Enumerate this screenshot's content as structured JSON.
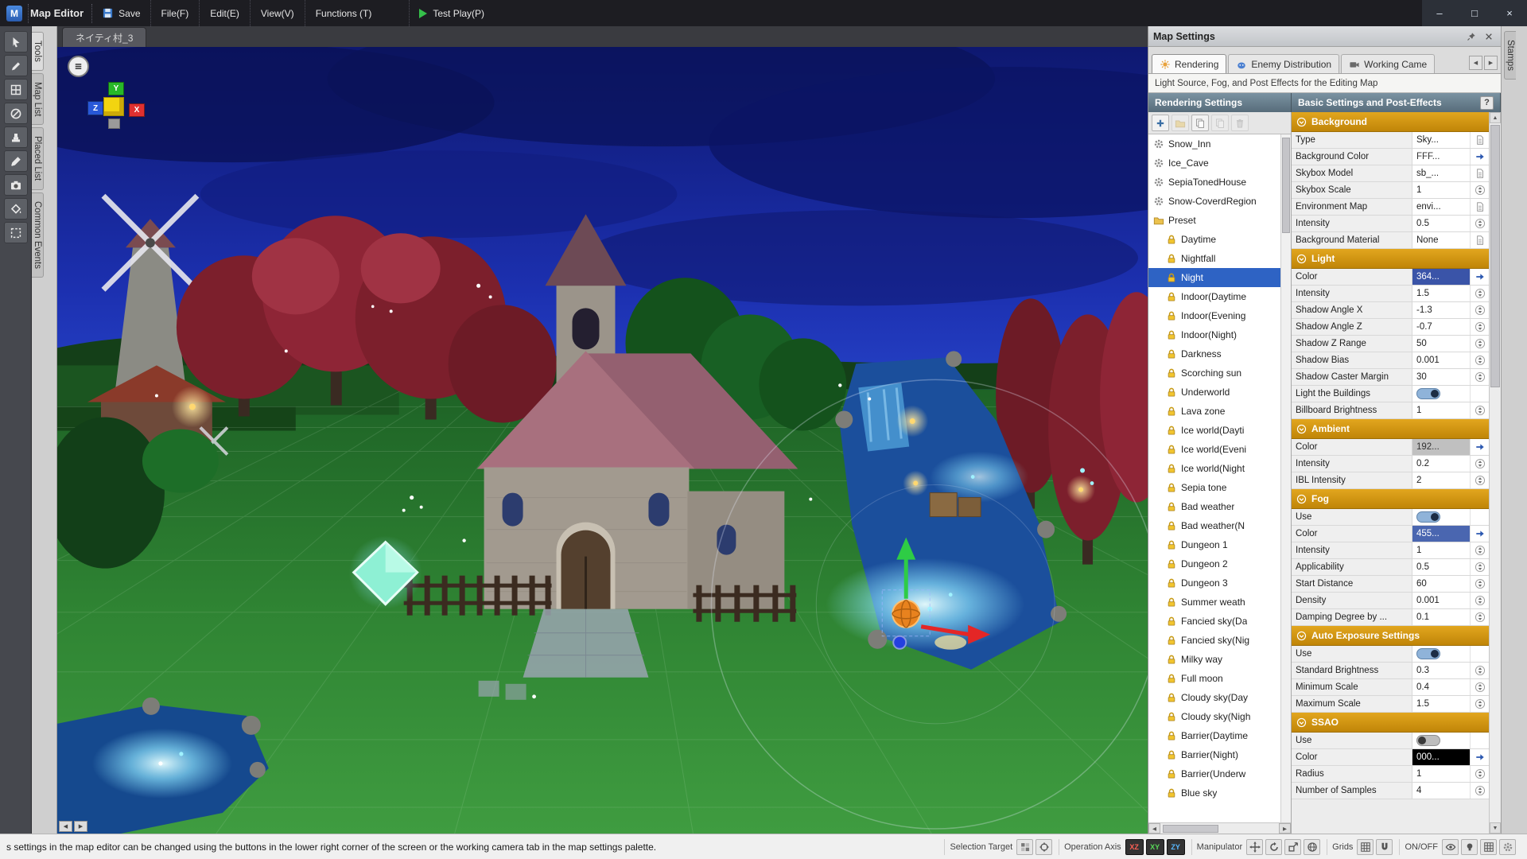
{
  "window": {
    "title": "Map Editor",
    "controls": {
      "minimize": "–",
      "maximize": "□",
      "close": "×"
    }
  },
  "menubar": {
    "save": "Save",
    "items": [
      "File(F)",
      "Edit(E)",
      "View(V)",
      "Functions (T)"
    ],
    "test_play": "Test Play(P)"
  },
  "left_toolbar": [
    {
      "name": "select-tool",
      "glyph": "cursor"
    },
    {
      "name": "pencil-tool",
      "glyph": "pencil"
    },
    {
      "name": "tileset-tool",
      "glyph": "tiles"
    },
    {
      "name": "slope-tool",
      "glyph": "circs"
    },
    {
      "name": "stamp-tool",
      "glyph": "stampi"
    },
    {
      "name": "eyedropper-tool",
      "glyph": "drop"
    },
    {
      "name": "screenshot-tool",
      "glyph": "cam2"
    },
    {
      "name": "fill-tool",
      "glyph": "bucket"
    },
    {
      "name": "selection-rect-tool",
      "glyph": "dashsq"
    }
  ],
  "left_tabs": [
    "Tools",
    "Map List",
    "Placed List",
    "Common Events"
  ],
  "right_edge_tab": "Stamps",
  "viewport": {
    "map_tab": "ネイティ村_3",
    "axis": {
      "x": "X",
      "y": "Y",
      "z": "Z"
    }
  },
  "map_settings": {
    "title": "Map Settings",
    "tabs": [
      {
        "label": "Rendering",
        "icon": "trender",
        "active": true
      },
      {
        "label": "Enemy Distribution",
        "icon": "tenemy",
        "active": false
      },
      {
        "label": "Working Came",
        "icon": "tcam",
        "active": false
      }
    ],
    "description": "Light Source, Fog, and Post Effects for the Editing Map",
    "rendering_settings": {
      "title": "Rendering Settings",
      "toolbar": [
        {
          "name": "add-rendering-setting-button",
          "glyph": "plus",
          "enabled": true
        },
        {
          "name": "add-folder-button",
          "glyph": "folder",
          "enabled": false
        },
        {
          "name": "duplicate-button",
          "glyph": "pages",
          "enabled": true
        },
        {
          "name": "paste-button",
          "glyph": "pages",
          "enabled": false
        },
        {
          "name": "delete-button",
          "glyph": "trash",
          "enabled": false
        }
      ],
      "items": [
        {
          "icon": "gear",
          "label": "Snow_Inn",
          "indent": 0,
          "selected": false
        },
        {
          "icon": "gear",
          "label": "Ice_Cave",
          "indent": 0,
          "selected": false
        },
        {
          "icon": "gear",
          "label": "SepiaTonedHouse",
          "indent": 0,
          "selected": false
        },
        {
          "icon": "gear",
          "label": "Snow-CoverdRegion",
          "indent": 0,
          "selected": false
        },
        {
          "icon": "folder",
          "label": "Preset",
          "indent": 0,
          "selected": false
        },
        {
          "icon": "preset",
          "label": "Daytime",
          "indent": 1,
          "selected": false
        },
        {
          "icon": "preset",
          "label": "Nightfall",
          "indent": 1,
          "selected": false
        },
        {
          "icon": "preset",
          "label": "Night",
          "indent": 1,
          "selected": true
        },
        {
          "icon": "preset",
          "label": "Indoor(Daytime",
          "indent": 1,
          "selected": false
        },
        {
          "icon": "preset",
          "label": "Indoor(Evening",
          "indent": 1,
          "selected": false
        },
        {
          "icon": "preset",
          "label": "Indoor(Night)",
          "indent": 1,
          "selected": false
        },
        {
          "icon": "preset",
          "label": "Darkness",
          "indent": 1,
          "selected": false
        },
        {
          "icon": "preset",
          "label": "Scorching sun",
          "indent": 1,
          "selected": false
        },
        {
          "icon": "preset",
          "label": "Underworld",
          "indent": 1,
          "selected": false
        },
        {
          "icon": "preset",
          "label": "Lava zone",
          "indent": 1,
          "selected": false
        },
        {
          "icon": "preset",
          "label": "Ice world(Dayti",
          "indent": 1,
          "selected": false
        },
        {
          "icon": "preset",
          "label": "Ice world(Eveni",
          "indent": 1,
          "selected": false
        },
        {
          "icon": "preset",
          "label": "Ice world(Night",
          "indent": 1,
          "selected": false
        },
        {
          "icon": "preset",
          "label": "Sepia tone",
          "indent": 1,
          "selected": false
        },
        {
          "icon": "preset",
          "label": "Bad weather",
          "indent": 1,
          "selected": false
        },
        {
          "icon": "preset",
          "label": "Bad weather(N",
          "indent": 1,
          "selected": false
        },
        {
          "icon": "preset",
          "label": "Dungeon 1",
          "indent": 1,
          "selected": false
        },
        {
          "icon": "preset",
          "label": "Dungeon 2",
          "indent": 1,
          "selected": false
        },
        {
          "icon": "preset",
          "label": "Dungeon 3",
          "indent": 1,
          "selected": false
        },
        {
          "icon": "preset",
          "label": "Summer weath",
          "indent": 1,
          "selected": false
        },
        {
          "icon": "preset",
          "label": "Fancied sky(Da",
          "indent": 1,
          "selected": false
        },
        {
          "icon": "preset",
          "label": "Fancied sky(Nig",
          "indent": 1,
          "selected": false
        },
        {
          "icon": "preset",
          "label": "Milky way",
          "indent": 1,
          "selected": false
        },
        {
          "icon": "preset",
          "label": "Full moon",
          "indent": 1,
          "selected": false
        },
        {
          "icon": "preset",
          "label": "Cloudy sky(Day",
          "indent": 1,
          "selected": false
        },
        {
          "icon": "preset",
          "label": "Cloudy sky(Nigh",
          "indent": 1,
          "selected": false
        },
        {
          "icon": "preset",
          "label": "Barrier(Daytime",
          "indent": 1,
          "selected": false
        },
        {
          "icon": "preset",
          "label": "Barrier(Night)",
          "indent": 1,
          "selected": false
        },
        {
          "icon": "preset",
          "label": "Barrier(Underw",
          "indent": 1,
          "selected": false
        },
        {
          "icon": "preset",
          "label": "Blue sky",
          "indent": 1,
          "selected": false
        }
      ]
    },
    "properties": {
      "title": "Basic Settings and Post-Effects",
      "help": "?",
      "sections": [
        {
          "label": "Background",
          "rows": [
            {
              "label": "Type",
              "value": "Sky...",
              "control": "file"
            },
            {
              "label": "Background Color",
              "value": "FFF...",
              "control": "arrow",
              "swatch": "#ffffff",
              "text": "#333333"
            },
            {
              "label": "Skybox Model",
              "value": "sb_...",
              "control": "file"
            },
            {
              "label": "Skybox Scale",
              "value": "1",
              "control": "spin"
            },
            {
              "label": "Environment Map",
              "value": "envi...",
              "control": "file"
            },
            {
              "label": "Intensity",
              "value": "0.5",
              "control": "spin"
            },
            {
              "label": "Background Material",
              "value": "None",
              "control": "file"
            }
          ]
        },
        {
          "label": "Light",
          "rows": [
            {
              "label": "Color",
              "value": "364...",
              "control": "arrow",
              "swatch": "#3a54a8",
              "text": "#ffffff"
            },
            {
              "label": "Intensity",
              "value": "1.5",
              "control": "spin"
            },
            {
              "label": "Shadow Angle X",
              "value": "-1.3",
              "control": "spin"
            },
            {
              "label": "Shadow Angle Z",
              "value": "-0.7",
              "control": "spin"
            },
            {
              "label": "Shadow Z Range",
              "value": "50",
              "control": "spin"
            },
            {
              "label": "Shadow Bias",
              "value": "0.001",
              "control": "spin"
            },
            {
              "label": "Shadow Caster Margin",
              "value": "30",
              "control": "spin"
            },
            {
              "label": "Light the Buildings",
              "control": "toggle",
              "on": true
            },
            {
              "label": "Billboard Brightness",
              "value": "1",
              "control": "spin"
            }
          ]
        },
        {
          "label": "Ambient",
          "rows": [
            {
              "label": "Color",
              "value": "192...",
              "control": "arrow",
              "swatch": "#c0c0c0",
              "text": "#333333"
            },
            {
              "label": "Intensity",
              "value": "0.2",
              "control": "spin"
            },
            {
              "label": "IBL Intensity",
              "value": "2",
              "control": "spin"
            }
          ]
        },
        {
          "label": "Fog",
          "rows": [
            {
              "label": "Use",
              "control": "toggle",
              "on": true
            },
            {
              "label": "Color",
              "value": "455...",
              "control": "arrow",
              "swatch": "#4a66b0",
              "text": "#ffffff"
            },
            {
              "label": "Intensity",
              "value": "1",
              "control": "spin"
            },
            {
              "label": "Applicability",
              "value": "0.5",
              "control": "spin"
            },
            {
              "label": "Start Distance",
              "value": "60",
              "control": "spin"
            },
            {
              "label": "Density",
              "value": "0.001",
              "control": "spin"
            },
            {
              "label": "Damping Degree by ...",
              "value": "0.1",
              "control": "spin"
            }
          ]
        },
        {
          "label": "Auto Exposure Settings",
          "rows": [
            {
              "label": "Use",
              "control": "toggle",
              "on": true
            },
            {
              "label": "Standard Brightness",
              "value": "0.3",
              "control": "spin"
            },
            {
              "label": "Minimum Scale",
              "value": "0.4",
              "control": "spin"
            },
            {
              "label": "Maximum Scale",
              "value": "1.5",
              "control": "spin"
            }
          ]
        },
        {
          "label": "SSAO",
          "rows": [
            {
              "label": "Use",
              "control": "toggle",
              "on": false
            },
            {
              "label": "Color",
              "value": "000...",
              "control": "arrow",
              "swatch": "#000000",
              "text": "#ffffff"
            },
            {
              "label": "Radius",
              "value": "1",
              "control": "spin"
            },
            {
              "label": "Number of Samples",
              "value": "4",
              "control": "spin"
            }
          ]
        }
      ]
    }
  },
  "statusbar": {
    "message": "s settings in the map editor can be changed using the buttons in the lower right corner of the screen or the working camera tab in the map settings palette.",
    "groups": [
      {
        "label": "Selection Target",
        "icons": [
          {
            "name": "stamp-selection-icon",
            "glyph": "boxes"
          },
          {
            "name": "object-selection-icon",
            "glyph": "target"
          }
        ]
      },
      {
        "label": "Operation Axis",
        "axes": [
          {
            "label": "XZ",
            "color": "#ff6055"
          },
          {
            "label": "XY",
            "color": "#58d858"
          },
          {
            "label": "ZY",
            "color": "#58b8ff"
          }
        ]
      },
      {
        "label": "Manipulator",
        "icons": [
          {
            "name": "move-manipulator-icon",
            "glyph": "move"
          },
          {
            "name": "rotate-manipulator-icon",
            "glyph": "rot"
          },
          {
            "name": "scale-manipulator-icon",
            "glyph": "scal"
          },
          {
            "name": "world-axis-icon",
            "glyph": "world"
          }
        ]
      },
      {
        "label": "Grids",
        "icons": [
          {
            "name": "grid-toggle-icon",
            "glyph": "grid"
          },
          {
            "name": "snap-toggle-icon",
            "glyph": "magnet"
          }
        ]
      },
      {
        "label": "ON/OFF",
        "icons": [
          {
            "name": "visibility-toggle-icon",
            "glyph": "eye"
          },
          {
            "name": "light-toggle-icon",
            "glyph": "bulb"
          },
          {
            "name": "grid-display-icon",
            "glyph": "grid"
          },
          {
            "name": "settings-icon",
            "glyph": "gear"
          }
        ]
      }
    ]
  }
}
